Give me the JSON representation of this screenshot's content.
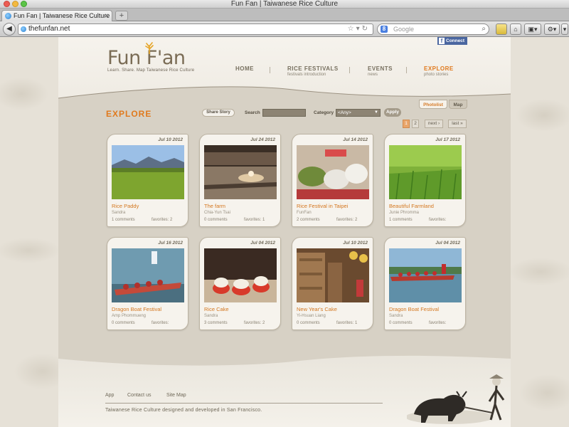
{
  "browser": {
    "window_title": "Fun Fan | Taiwanese Rice Culture",
    "tab_title": "Fun Fan | Taiwanese Rice Culture",
    "new_tab": "+",
    "url": "thefunfan.net",
    "search_placeholder": "Google",
    "search_engine_icon": "8"
  },
  "site": {
    "logo": "Fun F'an",
    "tagline": "Learn. Share. Map Taiwanese Rice Culture",
    "facebook_connect": "Connect",
    "nav": [
      {
        "label": "HOME",
        "sub": ""
      },
      {
        "label": "RICE FESTIVALS",
        "sub": "festivals introduction"
      },
      {
        "label": "EVENTS",
        "sub": "news"
      },
      {
        "label": "EXPLORE",
        "sub": "photo stories"
      }
    ],
    "active_nav_color": "#e07a1e"
  },
  "explore": {
    "title": "EXPLORE",
    "share_story": "Share Story",
    "search_label": "Search",
    "category_label": "Category",
    "category_value": "<Any>",
    "apply": "Apply",
    "view_tabs": [
      "Photolist",
      "Map"
    ],
    "pager": {
      "pages": [
        "1",
        "2"
      ],
      "next": "next ›",
      "last": "last »"
    }
  },
  "cards": [
    {
      "date": "Jul 10 2012",
      "title": "Rice Paddy",
      "author": "Sandra",
      "comments": "1 comments",
      "favorites": "favorites: 2"
    },
    {
      "date": "Jul 24 2012",
      "title": "The farm",
      "author": "Chia-Yun Tsai",
      "comments": "0 comments",
      "favorites": "favorites: 1"
    },
    {
      "date": "Jul 14 2012",
      "title": "Rice Festival in Taipei",
      "author": "FunFan",
      "comments": "2 comments",
      "favorites": "favorites: 2"
    },
    {
      "date": "Jul 17 2012",
      "title": "Beautiful Farmland",
      "author": "Junie Phromma",
      "comments": "1 comments",
      "favorites": "favorites:"
    },
    {
      "date": "Jul 16 2012",
      "title": "Dragon Boat Festival",
      "author": "Amp Phommueng",
      "comments": "0 comments",
      "favorites": "favorites:"
    },
    {
      "date": "Jul 04 2012",
      "title": "Rice Cake",
      "author": "Sandra",
      "comments": "3 comments",
      "favorites": "favorites: 2"
    },
    {
      "date": "Jul 10 2012",
      "title": "New Year's Cake",
      "author": "Yi-Hsuan Liang",
      "comments": "0 comments",
      "favorites": "favorites: 1"
    },
    {
      "date": "Jul 04 2012",
      "title": "Dragon Boat Festival",
      "author": "Sandra",
      "comments": "0 comments",
      "favorites": "favorites:"
    }
  ],
  "footer": {
    "links": [
      "App",
      "Contact us",
      "Site Map"
    ],
    "copyright": "Taiwanese Rice Culture designed and developed in San Francisco."
  }
}
